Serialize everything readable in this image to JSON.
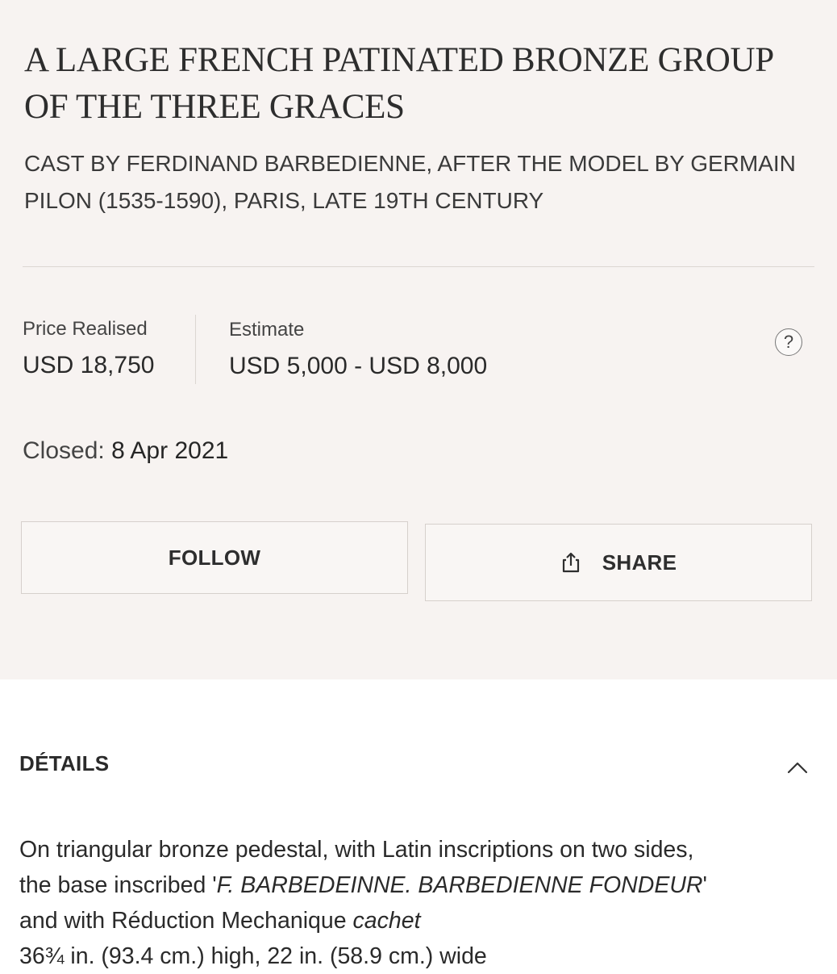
{
  "lot": {
    "title": "A LARGE FRENCH PATINATED BRONZE GROUP OF THE THREE GRACES",
    "subtitle": "CAST BY FERDINAND BARBEDIENNE, AFTER THE MODEL BY GERMAIN PILON (1535-1590), PARIS, LATE 19TH CENTURY"
  },
  "pricing": {
    "price_realised_label": "Price Realised",
    "price_realised_value": "USD 18,750",
    "estimate_label": "Estimate",
    "estimate_value": "USD 5,000 - USD 8,000",
    "help_icon": "question-mark-icon",
    "help_symbol": "?"
  },
  "status": {
    "closed_label": "Closed:",
    "closed_date": "8 Apr 2021"
  },
  "actions": {
    "follow_label": "FOLLOW",
    "share_label": "SHARE",
    "share_icon": "share-icon"
  },
  "details": {
    "title": "DÉTAILS",
    "toggle_icon": "chevron-up-icon",
    "line1": "On triangular bronze pedestal, with Latin inscriptions on two sides,",
    "line2_prefix": "the base inscribed '",
    "line2_italic": "F. BARBEDEINNE. BARBEDIENNE FONDEUR",
    "line2_suffix": "'",
    "line3_prefix": "and with Réduction Mechanique ",
    "line3_italic": "cachet",
    "line4": "36¾ in. (93.4 cm.) high, 22 in. (58.9 cm.) wide"
  },
  "colors": {
    "summary_background": "#f7f3f1",
    "page_background": "#ffffff",
    "border": "#d6d0cc",
    "text": "#262626"
  }
}
